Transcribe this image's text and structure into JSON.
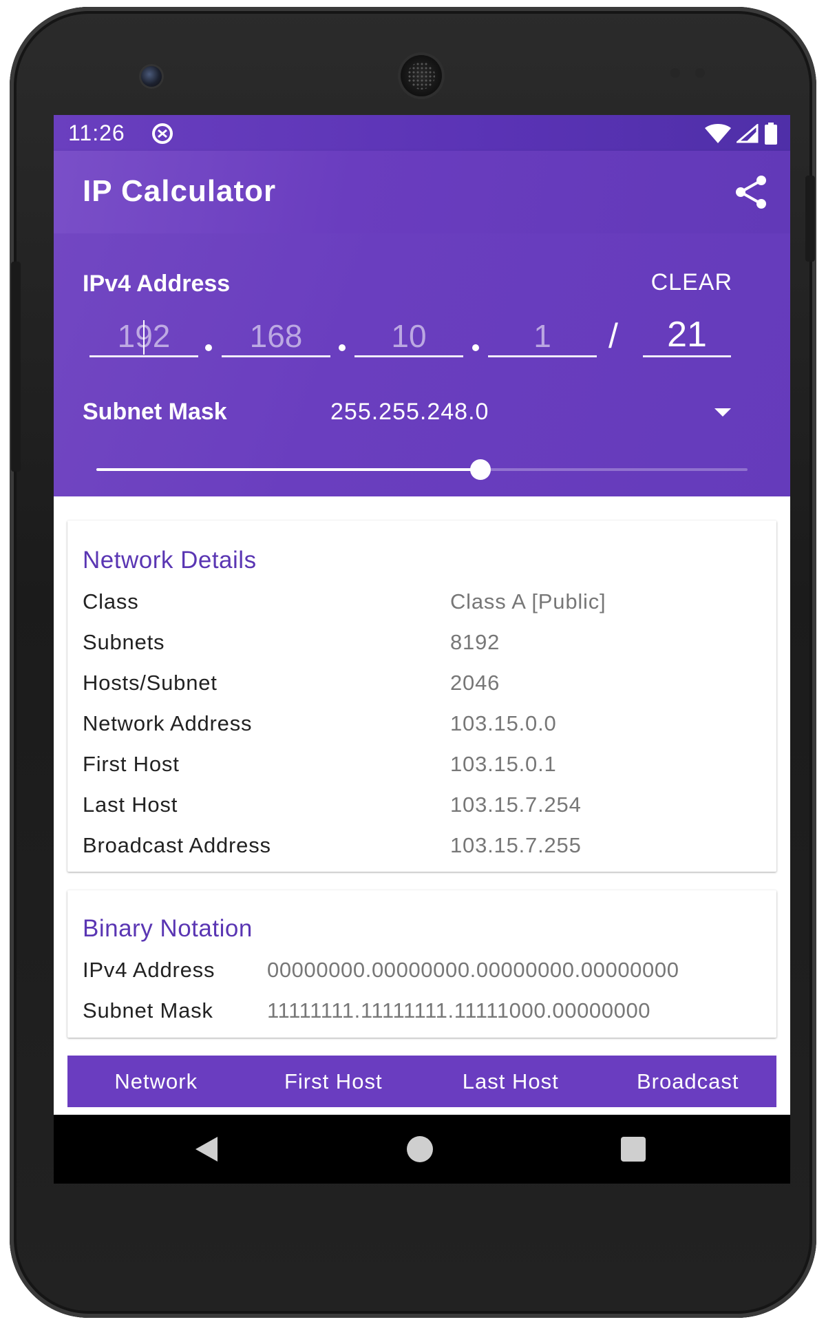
{
  "status_bar": {
    "time": "11:26",
    "notification_icon": "data-saver-icon",
    "wifi_icon": "wifi-icon",
    "signal_icon": "cell-signal-icon",
    "battery_icon": "battery-icon"
  },
  "app_bar": {
    "title": "IP Calculator",
    "share_icon": "share-icon"
  },
  "ip_input": {
    "label": "IPv4 Address",
    "clear_label": "CLEAR",
    "octets": [
      "192",
      "168",
      "10",
      "1"
    ],
    "separator": ".",
    "slash": "/",
    "prefix": "21"
  },
  "subnet_mask": {
    "label": "Subnet Mask",
    "value": "255.255.248.0",
    "dropdown_icon": "dropdown-arrow-icon",
    "slider_level_fraction": 0.59
  },
  "network_details": {
    "title": "Network Details",
    "rows": [
      {
        "label": "Class",
        "value": "Class A [Public]"
      },
      {
        "label": "Subnets",
        "value": "8192"
      },
      {
        "label": "Hosts/Subnet",
        "value": "2046"
      },
      {
        "label": "Network Address",
        "value": "103.15.0.0"
      },
      {
        "label": "First Host",
        "value": "103.15.0.1"
      },
      {
        "label": "Last Host",
        "value": "103.15.7.254"
      },
      {
        "label": "Broadcast Address",
        "value": "103.15.7.255"
      }
    ]
  },
  "binary_notation": {
    "title": "Binary Notation",
    "rows": [
      {
        "label": "IPv4 Address",
        "value": "00000000.00000000.00000000.00000000"
      },
      {
        "label": "Subnet Mask",
        "value": "11111111.11111111.11111000.00000000"
      }
    ]
  },
  "actions": [
    "Network",
    "First Host",
    "Last Host",
    "Broadcast"
  ],
  "nav_bar": {
    "back_icon": "back-triangle-icon",
    "home_icon": "home-circle-icon",
    "recents_icon": "recents-square-icon"
  },
  "colors": {
    "primary": "#6a3dc0",
    "primary_dark": "#512da8",
    "accent_text": "#5a36b3",
    "value_text": "#777777"
  }
}
